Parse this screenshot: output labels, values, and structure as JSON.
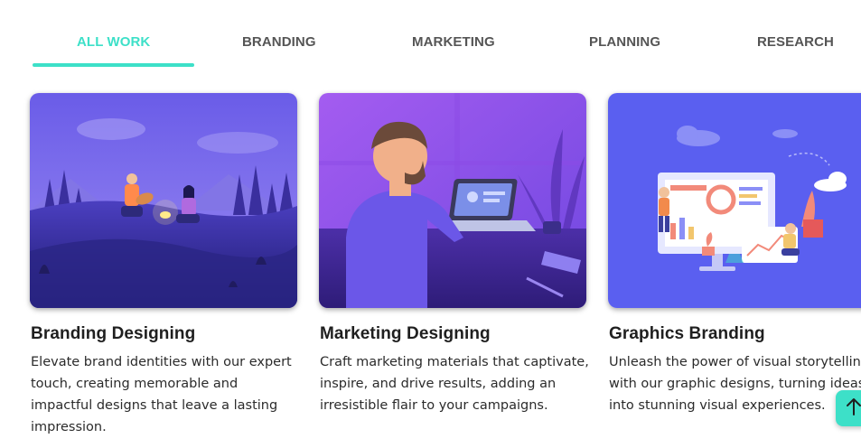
{
  "tabs": [
    {
      "label": "ALL WORK",
      "active": true
    },
    {
      "label": "BRANDING",
      "active": false
    },
    {
      "label": "MARKETING",
      "active": false
    },
    {
      "label": "PLANNING",
      "active": false
    },
    {
      "label": "RESEARCH",
      "active": false
    }
  ],
  "cards": [
    {
      "title": "Branding Designing",
      "description": "Elevate brand identities with our expert touch, creating memorable and impactful designs that leave a lasting impression.",
      "image": "guitar-campfire-illustration"
    },
    {
      "title": "Marketing Designing",
      "description": "Craft marketing materials that captivate, inspire, and drive results, adding an irresistible flair to your campaigns.",
      "image": "man-at-laptop-illustration"
    },
    {
      "title": "Graphics Branding",
      "description": "Unleash the power of visual storytelling with our graphic designs, turning ideas into stunning visual experiences.",
      "image": "dashboard-graphics-illustration"
    }
  ],
  "colors": {
    "accent": "#3de0c8",
    "tab_inactive": "#555555",
    "heading": "#1f1f1f"
  },
  "scroll_top": {
    "icon": "arrow-up-icon"
  }
}
